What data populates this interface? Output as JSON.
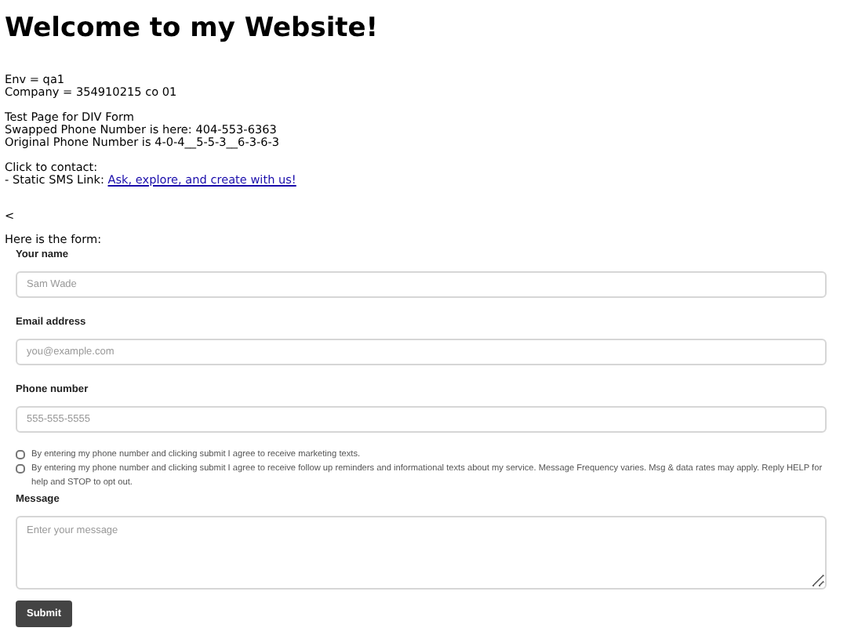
{
  "heading": "Welcome to my Website!",
  "info_blocks": [
    [
      "Env = qa1",
      "Company = 354910215 co 01"
    ],
    [
      "Test Page for DIV Form",
      "Swapped Phone Number is here: 404-553-6363",
      "Original Phone Number is 4-0-4__5-5-3__6-3-6-3"
    ]
  ],
  "contact": {
    "title": "Click to contact:",
    "prefix": "- Static SMS Link: ",
    "link": "Ask, explore, and create with us!"
  },
  "back_mark": "<",
  "form_intro": "Here is the form:",
  "form": {
    "fields": [
      {
        "kind": "input",
        "label": "Your name",
        "placeholder": "Sam Wade"
      },
      {
        "kind": "input",
        "label": "Email address",
        "placeholder": "you@example.com"
      },
      {
        "kind": "input",
        "label": "Phone number",
        "placeholder": "555-555-5555"
      },
      {
        "kind": "checkbox",
        "label": "By entering my phone number and clicking submit I agree to receive marketing texts.",
        "checked": false
      },
      {
        "kind": "checkbox",
        "label": "By entering my phone number and clicking submit I agree to receive follow up reminders and informational texts about my service. Message Frequency varies. Msg & data rates may apply. Reply HELP for help and STOP to opt out.",
        "checked": false
      },
      {
        "kind": "textarea",
        "label": "Message",
        "placeholder": "Enter your message"
      }
    ],
    "submit": "Submit"
  }
}
